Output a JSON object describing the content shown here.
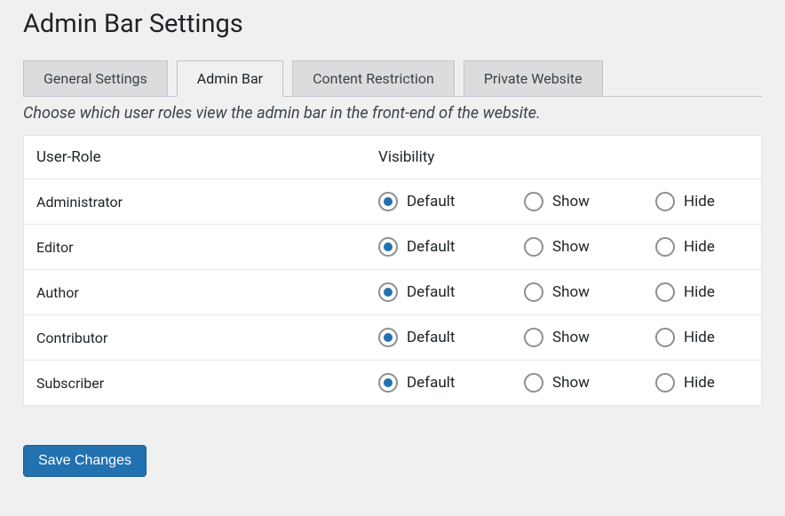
{
  "page": {
    "title": "Admin Bar Settings",
    "subtitle": "Choose which user roles view the admin bar in the front-end of the website."
  },
  "tabs": [
    {
      "label": "General Settings",
      "active": false
    },
    {
      "label": "Admin Bar",
      "active": true
    },
    {
      "label": "Content Restriction",
      "active": false
    },
    {
      "label": "Private Website",
      "active": false
    }
  ],
  "table": {
    "header_role": "User-Role",
    "header_visibility": "Visibility",
    "option_labels": {
      "default": "Default",
      "show": "Show",
      "hide": "Hide"
    },
    "rows": [
      {
        "role": "Administrator",
        "selected": "default"
      },
      {
        "role": "Editor",
        "selected": "default"
      },
      {
        "role": "Author",
        "selected": "default"
      },
      {
        "role": "Contributor",
        "selected": "default"
      },
      {
        "role": "Subscriber",
        "selected": "default"
      }
    ]
  },
  "buttons": {
    "save": "Save Changes"
  }
}
